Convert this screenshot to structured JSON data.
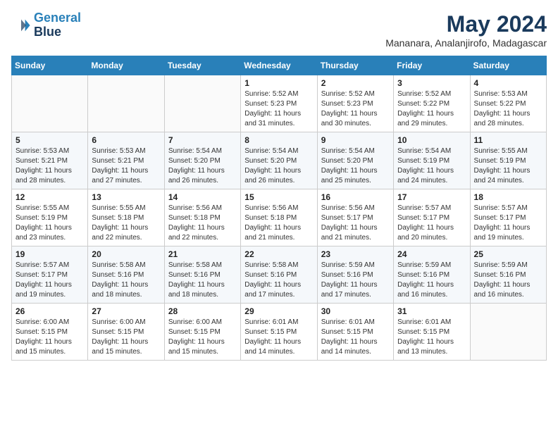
{
  "header": {
    "logo_line1": "General",
    "logo_line2": "Blue",
    "month": "May 2024",
    "location": "Mananara, Analanjirofo, Madagascar"
  },
  "weekdays": [
    "Sunday",
    "Monday",
    "Tuesday",
    "Wednesday",
    "Thursday",
    "Friday",
    "Saturday"
  ],
  "weeks": [
    [
      {
        "day": "",
        "info": ""
      },
      {
        "day": "",
        "info": ""
      },
      {
        "day": "",
        "info": ""
      },
      {
        "day": "1",
        "info": "Sunrise: 5:52 AM\nSunset: 5:23 PM\nDaylight: 11 hours\nand 31 minutes."
      },
      {
        "day": "2",
        "info": "Sunrise: 5:52 AM\nSunset: 5:23 PM\nDaylight: 11 hours\nand 30 minutes."
      },
      {
        "day": "3",
        "info": "Sunrise: 5:52 AM\nSunset: 5:22 PM\nDaylight: 11 hours\nand 29 minutes."
      },
      {
        "day": "4",
        "info": "Sunrise: 5:53 AM\nSunset: 5:22 PM\nDaylight: 11 hours\nand 28 minutes."
      }
    ],
    [
      {
        "day": "5",
        "info": "Sunrise: 5:53 AM\nSunset: 5:21 PM\nDaylight: 11 hours\nand 28 minutes."
      },
      {
        "day": "6",
        "info": "Sunrise: 5:53 AM\nSunset: 5:21 PM\nDaylight: 11 hours\nand 27 minutes."
      },
      {
        "day": "7",
        "info": "Sunrise: 5:54 AM\nSunset: 5:20 PM\nDaylight: 11 hours\nand 26 minutes."
      },
      {
        "day": "8",
        "info": "Sunrise: 5:54 AM\nSunset: 5:20 PM\nDaylight: 11 hours\nand 26 minutes."
      },
      {
        "day": "9",
        "info": "Sunrise: 5:54 AM\nSunset: 5:20 PM\nDaylight: 11 hours\nand 25 minutes."
      },
      {
        "day": "10",
        "info": "Sunrise: 5:54 AM\nSunset: 5:19 PM\nDaylight: 11 hours\nand 24 minutes."
      },
      {
        "day": "11",
        "info": "Sunrise: 5:55 AM\nSunset: 5:19 PM\nDaylight: 11 hours\nand 24 minutes."
      }
    ],
    [
      {
        "day": "12",
        "info": "Sunrise: 5:55 AM\nSunset: 5:19 PM\nDaylight: 11 hours\nand 23 minutes."
      },
      {
        "day": "13",
        "info": "Sunrise: 5:55 AM\nSunset: 5:18 PM\nDaylight: 11 hours\nand 22 minutes."
      },
      {
        "day": "14",
        "info": "Sunrise: 5:56 AM\nSunset: 5:18 PM\nDaylight: 11 hours\nand 22 minutes."
      },
      {
        "day": "15",
        "info": "Sunrise: 5:56 AM\nSunset: 5:18 PM\nDaylight: 11 hours\nand 21 minutes."
      },
      {
        "day": "16",
        "info": "Sunrise: 5:56 AM\nSunset: 5:17 PM\nDaylight: 11 hours\nand 21 minutes."
      },
      {
        "day": "17",
        "info": "Sunrise: 5:57 AM\nSunset: 5:17 PM\nDaylight: 11 hours\nand 20 minutes."
      },
      {
        "day": "18",
        "info": "Sunrise: 5:57 AM\nSunset: 5:17 PM\nDaylight: 11 hours\nand 19 minutes."
      }
    ],
    [
      {
        "day": "19",
        "info": "Sunrise: 5:57 AM\nSunset: 5:17 PM\nDaylight: 11 hours\nand 19 minutes."
      },
      {
        "day": "20",
        "info": "Sunrise: 5:58 AM\nSunset: 5:16 PM\nDaylight: 11 hours\nand 18 minutes."
      },
      {
        "day": "21",
        "info": "Sunrise: 5:58 AM\nSunset: 5:16 PM\nDaylight: 11 hours\nand 18 minutes."
      },
      {
        "day": "22",
        "info": "Sunrise: 5:58 AM\nSunset: 5:16 PM\nDaylight: 11 hours\nand 17 minutes."
      },
      {
        "day": "23",
        "info": "Sunrise: 5:59 AM\nSunset: 5:16 PM\nDaylight: 11 hours\nand 17 minutes."
      },
      {
        "day": "24",
        "info": "Sunrise: 5:59 AM\nSunset: 5:16 PM\nDaylight: 11 hours\nand 16 minutes."
      },
      {
        "day": "25",
        "info": "Sunrise: 5:59 AM\nSunset: 5:16 PM\nDaylight: 11 hours\nand 16 minutes."
      }
    ],
    [
      {
        "day": "26",
        "info": "Sunrise: 6:00 AM\nSunset: 5:15 PM\nDaylight: 11 hours\nand 15 minutes."
      },
      {
        "day": "27",
        "info": "Sunrise: 6:00 AM\nSunset: 5:15 PM\nDaylight: 11 hours\nand 15 minutes."
      },
      {
        "day": "28",
        "info": "Sunrise: 6:00 AM\nSunset: 5:15 PM\nDaylight: 11 hours\nand 15 minutes."
      },
      {
        "day": "29",
        "info": "Sunrise: 6:01 AM\nSunset: 5:15 PM\nDaylight: 11 hours\nand 14 minutes."
      },
      {
        "day": "30",
        "info": "Sunrise: 6:01 AM\nSunset: 5:15 PM\nDaylight: 11 hours\nand 14 minutes."
      },
      {
        "day": "31",
        "info": "Sunrise: 6:01 AM\nSunset: 5:15 PM\nDaylight: 11 hours\nand 13 minutes."
      },
      {
        "day": "",
        "info": ""
      }
    ]
  ]
}
